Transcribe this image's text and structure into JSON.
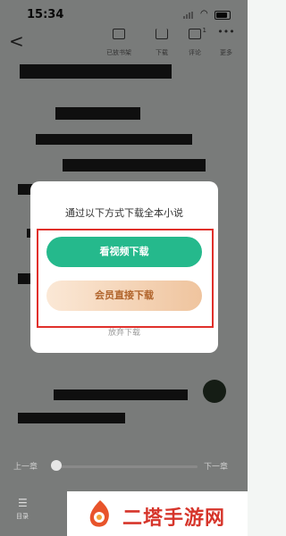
{
  "status_bar": {
    "time": "15:34"
  },
  "toolbar": {
    "back": "<",
    "items": [
      {
        "label": "已放书架"
      },
      {
        "label": "下载"
      },
      {
        "label": "评论",
        "badge": "1"
      },
      {
        "label": "更多"
      }
    ]
  },
  "modal": {
    "title": "通过以下方式下载全本小说",
    "video_button": "看视频下载",
    "vip_button": "会员直接下载",
    "give_up": "放弃下载"
  },
  "progress": {
    "prev": "上一章",
    "next": "下一章",
    "fraction": 0.0
  },
  "bottom_nav": {
    "menu_label": "目录"
  },
  "watermark": {
    "text": "二塔手游网"
  },
  "colors": {
    "accent_green": "#25b98c",
    "highlight_red": "#e0302b",
    "watermark_red": "#d6352b"
  }
}
